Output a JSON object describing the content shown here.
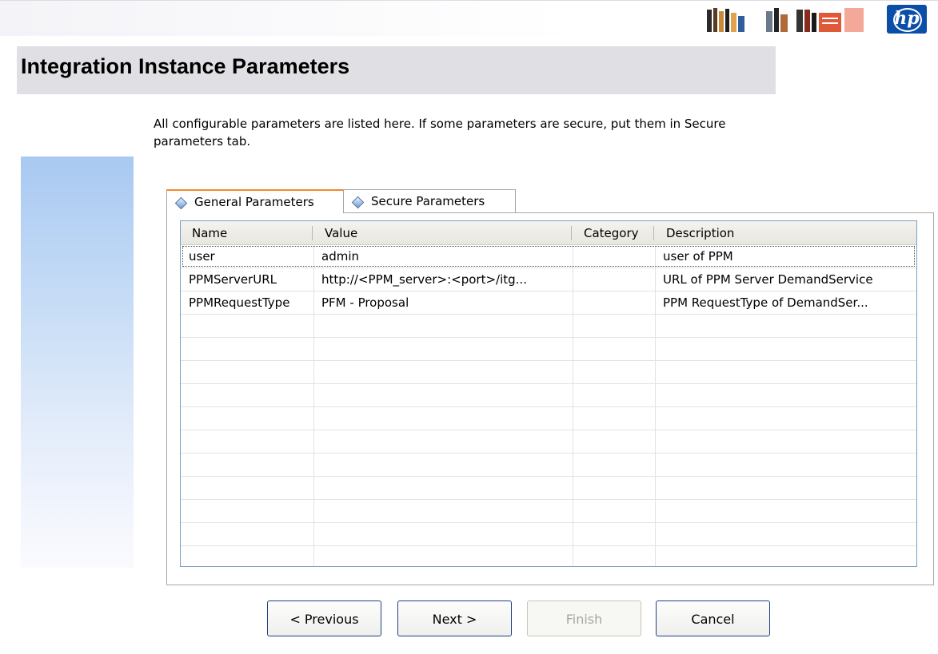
{
  "header": {
    "title": "Integration Instance Parameters",
    "logo_text": "hp"
  },
  "intro_text": "All configurable parameters are listed here. If some parameters are secure, put them in Secure parameters tab.",
  "tabs": [
    {
      "label": "General Parameters",
      "active": true
    },
    {
      "label": "Secure Parameters",
      "active": false
    }
  ],
  "table": {
    "columns": [
      "Name",
      "Value",
      "Category",
      "Description"
    ],
    "rows": [
      [
        "user",
        "admin",
        "",
        "user of PPM"
      ],
      [
        "PPMServerURL",
        "http://<PPM_server>:<port>/itg...",
        "",
        "URL of PPM Server DemandService"
      ],
      [
        "PPMRequestType",
        "PFM - Proposal",
        "",
        "PPM RequestType of DemandSer..."
      ]
    ]
  },
  "buttons": {
    "previous": "< Previous",
    "next": "Next >",
    "finish": "Finish",
    "cancel": "Cancel"
  },
  "colors": {
    "title_bar": "#e0dfe3",
    "active_tab_accent": "#f28a2b",
    "hp_blue": "#0a4ea8",
    "button_border": "#1f3f86"
  }
}
